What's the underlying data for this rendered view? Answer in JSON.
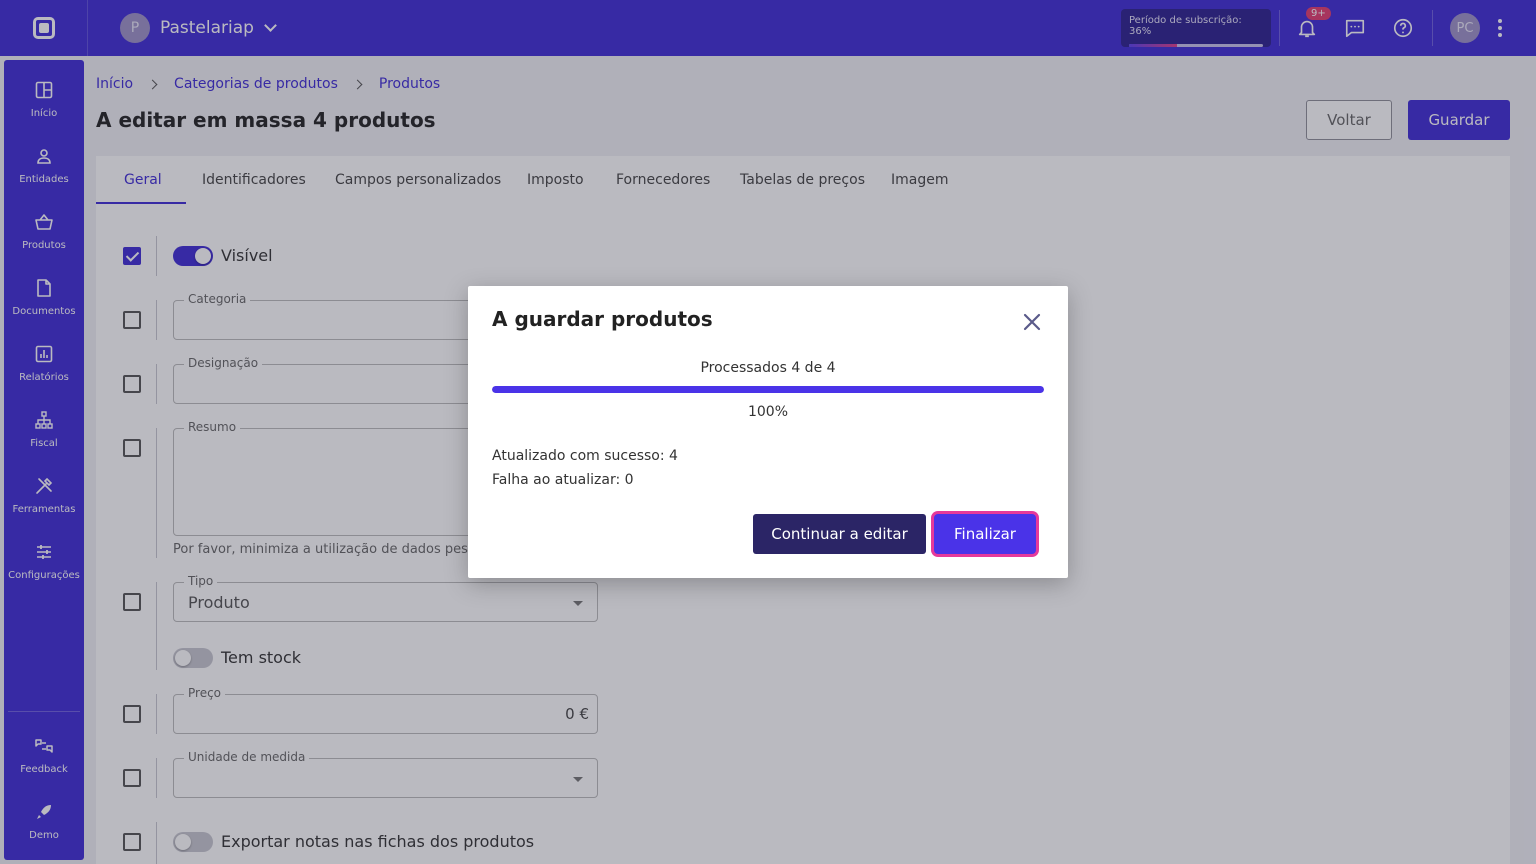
{
  "topbar": {
    "account_initial": "P",
    "account_name": "Pastelariap",
    "subscription_label": "Período de subscrição: 36%",
    "subscription_progress": 0.36,
    "notifications_badge": "9+",
    "user_initials": "PC"
  },
  "sidebar": {
    "items": [
      {
        "label": "Início",
        "icon": "grid-icon"
      },
      {
        "label": "Entidades",
        "icon": "person-icon"
      },
      {
        "label": "Produtos",
        "icon": "basket-icon"
      },
      {
        "label": "Documentos",
        "icon": "document-icon"
      },
      {
        "label": "Relatórios",
        "icon": "chart-icon"
      },
      {
        "label": "Fiscal",
        "icon": "hierarchy-icon"
      },
      {
        "label": "Ferramentas",
        "icon": "tools-icon"
      },
      {
        "label": "Configurações",
        "icon": "sliders-icon"
      }
    ],
    "bottom": [
      {
        "label": "Feedback",
        "icon": "feedback-icon"
      },
      {
        "label": "Demo",
        "icon": "rocket-icon"
      }
    ]
  },
  "breadcrumb": [
    "Início",
    "Categorias de produtos",
    "Produtos"
  ],
  "page": {
    "title": "A editar em massa 4 produtos",
    "back_label": "Voltar",
    "save_label": "Guardar"
  },
  "tabs": [
    "Geral",
    "Identificadores",
    "Campos personalizados",
    "Imposto",
    "Fornecedores",
    "Tabelas de preços",
    "Imagem"
  ],
  "form": {
    "visible_label": "Visível",
    "category_label": "Categoria",
    "designation_label": "Designação",
    "summary_label": "Resumo",
    "summary_hint": "Por favor, minimiza a utilização de dados pesso",
    "type_label": "Tipo",
    "type_value": "Produto",
    "stock_label": "Tem stock",
    "price_label": "Preço",
    "price_value": "0 €",
    "unit_label": "Unidade de medida",
    "export_notes_label": "Exportar notas nas fichas dos produtos"
  },
  "dialog": {
    "title": "A guardar produtos",
    "progress_text": "Processados 4 de 4",
    "progress": 1.0,
    "percent": "100%",
    "success_text": "Atualizado com sucesso: 4",
    "fail_text": "Falha ao atualizar: 0",
    "continue_label": "Continuar a editar",
    "finish_label": "Finalizar"
  },
  "colors": {
    "brand": "#3f2bd6",
    "dark_button": "#2b2566",
    "focus_ring": "#e6399b"
  }
}
